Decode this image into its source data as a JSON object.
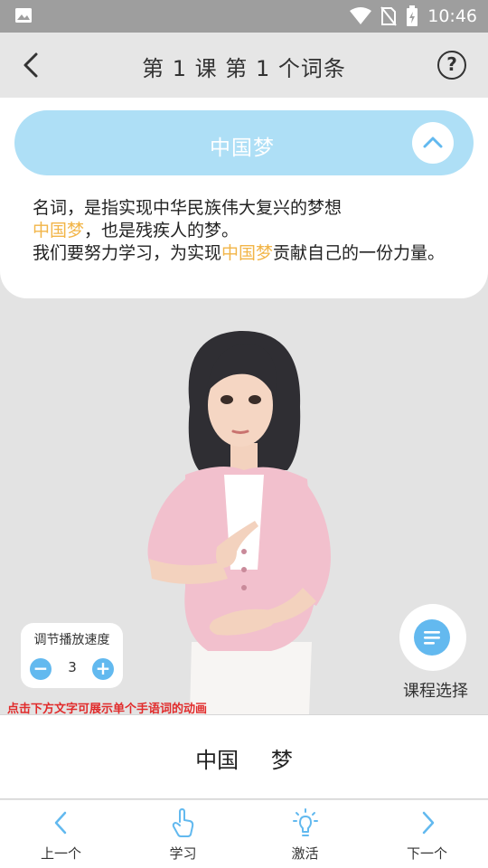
{
  "status": {
    "time": "10:46"
  },
  "header": {
    "title": "第 1 课 第 1 个词条"
  },
  "word": {
    "text": "中国梦"
  },
  "definition": {
    "line1": "名词，是指实现中华民族伟大复兴的梦想",
    "hl1": "中国梦",
    "line2": "，也是残疾人的梦。",
    "line3_pre": "我们要努力学习，为实现",
    "hl2": "中国梦",
    "line3_post": "贡献自己的一份力量。"
  },
  "speed": {
    "label": "调节播放速度",
    "value": "3",
    "minus": "−",
    "plus": "+"
  },
  "course": {
    "label": "课程选择"
  },
  "hint": "点击下方文字可展示单个手语词的动画",
  "words": [
    "中国",
    "梦"
  ],
  "nav": [
    {
      "label": "上一个",
      "icon": "chevron-left-icon"
    },
    {
      "label": "学习",
      "icon": "hand-pointer-icon"
    },
    {
      "label": "激活",
      "icon": "lightbulb-icon"
    },
    {
      "label": "下一个",
      "icon": "chevron-right-icon"
    }
  ],
  "colors": {
    "accent": "#62b9ef",
    "pill": "#aedff6",
    "highlight": "#f2b548",
    "hint": "#e12b2b"
  }
}
